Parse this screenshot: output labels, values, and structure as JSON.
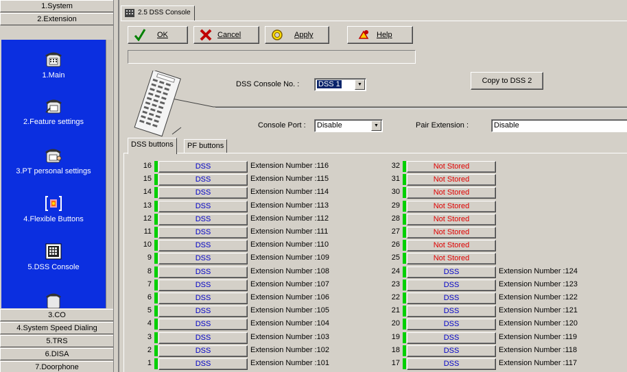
{
  "sidebar": {
    "categories_top": [
      {
        "label": "1.System"
      },
      {
        "label": "2.Extension"
      }
    ],
    "nav_items": [
      {
        "label": "1.Main",
        "icon": "phone-icon"
      },
      {
        "label": "2.Feature settings",
        "icon": "phone-settings-icon"
      },
      {
        "label": "3.PT personal settings",
        "icon": "phone-person-icon"
      },
      {
        "label": "4.Flexible Buttons",
        "icon": "flexible-buttons-icon"
      },
      {
        "label": "5.DSS Console",
        "icon": "dss-console-icon"
      }
    ],
    "categories_bottom": [
      {
        "label": "3.CO"
      },
      {
        "label": "4.System Speed Dialing"
      },
      {
        "label": "5.TRS"
      },
      {
        "label": "6.DISA"
      },
      {
        "label": "7.Doorphone"
      }
    ]
  },
  "window_tab": {
    "label": "2.5 DSS Console"
  },
  "toolbar": {
    "ok": "OK",
    "cancel": "Cancel",
    "apply": "Apply",
    "help": "Help"
  },
  "console": {
    "no_label": "DSS Console No. :",
    "no_value": "DSS 1",
    "copy_button": "Copy to DSS 2",
    "port_label": "Console Port :",
    "port_value": "Disable",
    "pair_label": "Pair Extension :",
    "pair_value": "Disable"
  },
  "subtabs": [
    {
      "label": "DSS buttons"
    },
    {
      "label": "PF buttons"
    }
  ],
  "left_column": [
    {
      "n": "16",
      "btn": "DSS",
      "ext": "Extension Number :116"
    },
    {
      "n": "15",
      "btn": "DSS",
      "ext": "Extension Number :115"
    },
    {
      "n": "14",
      "btn": "DSS",
      "ext": "Extension Number :114"
    },
    {
      "n": "13",
      "btn": "DSS",
      "ext": "Extension Number :113"
    },
    {
      "n": "12",
      "btn": "DSS",
      "ext": "Extension Number :112"
    },
    {
      "n": "11",
      "btn": "DSS",
      "ext": "Extension Number :111"
    },
    {
      "n": "10",
      "btn": "DSS",
      "ext": "Extension Number :110"
    },
    {
      "n": "9",
      "btn": "DSS",
      "ext": "Extension Number :109"
    },
    {
      "n": "8",
      "btn": "DSS",
      "ext": "Extension Number :108"
    },
    {
      "n": "7",
      "btn": "DSS",
      "ext": "Extension Number :107"
    },
    {
      "n": "6",
      "btn": "DSS",
      "ext": "Extension Number :106"
    },
    {
      "n": "5",
      "btn": "DSS",
      "ext": "Extension Number :105"
    },
    {
      "n": "4",
      "btn": "DSS",
      "ext": "Extension Number :104"
    },
    {
      "n": "3",
      "btn": "DSS",
      "ext": "Extension Number :103"
    },
    {
      "n": "2",
      "btn": "DSS",
      "ext": "Extension Number :102"
    },
    {
      "n": "1",
      "btn": "DSS",
      "ext": "Extension Number :101"
    }
  ],
  "right_column": [
    {
      "n": "32",
      "btn": "Not Stored",
      "ext": ""
    },
    {
      "n": "31",
      "btn": "Not Stored",
      "ext": ""
    },
    {
      "n": "30",
      "btn": "Not Stored",
      "ext": ""
    },
    {
      "n": "29",
      "btn": "Not Stored",
      "ext": ""
    },
    {
      "n": "28",
      "btn": "Not Stored",
      "ext": ""
    },
    {
      "n": "27",
      "btn": "Not Stored",
      "ext": ""
    },
    {
      "n": "26",
      "btn": "Not Stored",
      "ext": ""
    },
    {
      "n": "25",
      "btn": "Not Stored",
      "ext": ""
    },
    {
      "n": "24",
      "btn": "DSS",
      "ext": "Extension Number :124"
    },
    {
      "n": "23",
      "btn": "DSS",
      "ext": "Extension Number :123"
    },
    {
      "n": "22",
      "btn": "DSS",
      "ext": "Extension Number :122"
    },
    {
      "n": "21",
      "btn": "DSS",
      "ext": "Extension Number :121"
    },
    {
      "n": "20",
      "btn": "DSS",
      "ext": "Extension Number :120"
    },
    {
      "n": "19",
      "btn": "DSS",
      "ext": "Extension Number :119"
    },
    {
      "n": "18",
      "btn": "DSS",
      "ext": "Extension Number :118"
    },
    {
      "n": "17",
      "btn": "DSS",
      "ext": "Extension Number :117"
    }
  ],
  "colors": {
    "nav_panel": "#0b2fe0",
    "led": "#00d000",
    "dss_text": "#0000c8",
    "not_stored_text": "#e00000",
    "selection": "#0a246a"
  }
}
